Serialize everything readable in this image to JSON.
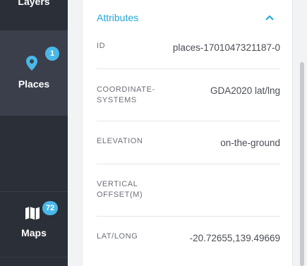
{
  "sidebar": {
    "items": [
      {
        "label": "Layers",
        "icon": "layers-icon"
      },
      {
        "label": "Places",
        "icon": "map-pin-icon",
        "badge": "1"
      },
      {
        "label": "Maps",
        "icon": "map-icon",
        "badge": "72"
      }
    ]
  },
  "attributes": {
    "title": "Attributes",
    "rows": [
      {
        "label": "ID",
        "value": "places-1701047321187-0"
      },
      {
        "label": "COORDINATE-SYSTEMS",
        "value": "GDA2020 lat/lng"
      },
      {
        "label": "ELEVATION",
        "value": "on-the-ground"
      },
      {
        "label": "VERTICAL OFFSET(M)",
        "value": ""
      },
      {
        "label": "LAT/LONG",
        "value": "-20.72655,139.49669"
      }
    ]
  },
  "colors": {
    "sidebar_bg": "#2b2f38",
    "sidebar_active_bg": "#3b3f4b",
    "accent": "#1fa8d9",
    "badge": "#48b8e8"
  }
}
